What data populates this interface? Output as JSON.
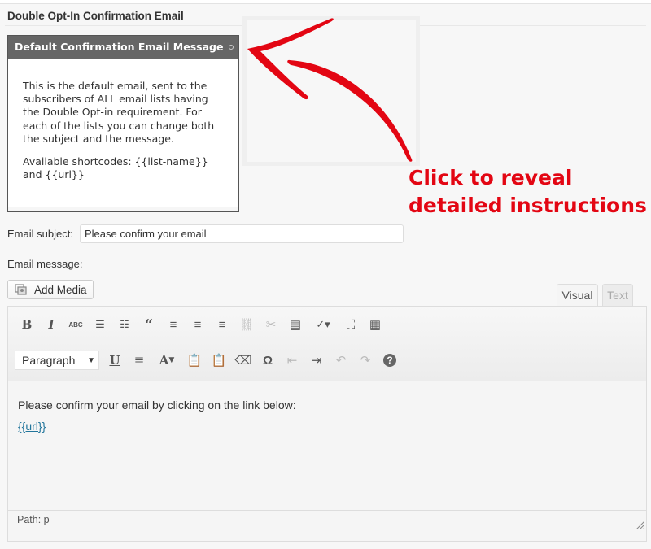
{
  "panel": {
    "title": "Double Opt-In Confirmation Email"
  },
  "tip": {
    "title": "Default Confirmation Email Message",
    "paragraph1": "This is the default email, sent to the subscribers of ALL email lists having the Double Opt-in requirement. For each of the lists you can change both the subject and the message.",
    "paragraph2": "Available shortcodes: {{list-name}} and {{url}}"
  },
  "callout": {
    "line1": "Click to reveal",
    "line2": "detailed instructions",
    "color": "#e30613"
  },
  "form": {
    "subject_label": "Email subject:",
    "subject_value": "Please confirm your email",
    "message_label": "Email message:"
  },
  "editor": {
    "add_media_label": "Add Media",
    "tabs": [
      {
        "label": "Visual",
        "active": true
      },
      {
        "label": "Text",
        "active": false
      }
    ],
    "toolbar_row1": [
      "bold-icon",
      "italic-icon",
      "strikethrough-icon",
      "bullet-list-icon",
      "numbered-list-icon",
      "blockquote-icon",
      "align-left-icon",
      "align-center-icon",
      "align-right-icon",
      "link-icon",
      "unlink-icon",
      "more-tag-icon",
      "spellcheck-icon",
      "fullscreen-icon",
      "kitchen-sink-icon"
    ],
    "toolbar_row2": [
      "underline-icon",
      "justify-icon",
      "text-color-icon",
      "paste-text-icon",
      "paste-word-icon",
      "clear-formatting-icon",
      "special-character-icon",
      "outdent-icon",
      "indent-icon",
      "undo-icon",
      "redo-icon",
      "help-icon"
    ],
    "format_select": "Paragraph",
    "content_line": "Please confirm your email by clicking on the link below:",
    "content_link": "{{url}}",
    "path_label": "Path: p",
    "link_color": "#21759b"
  }
}
